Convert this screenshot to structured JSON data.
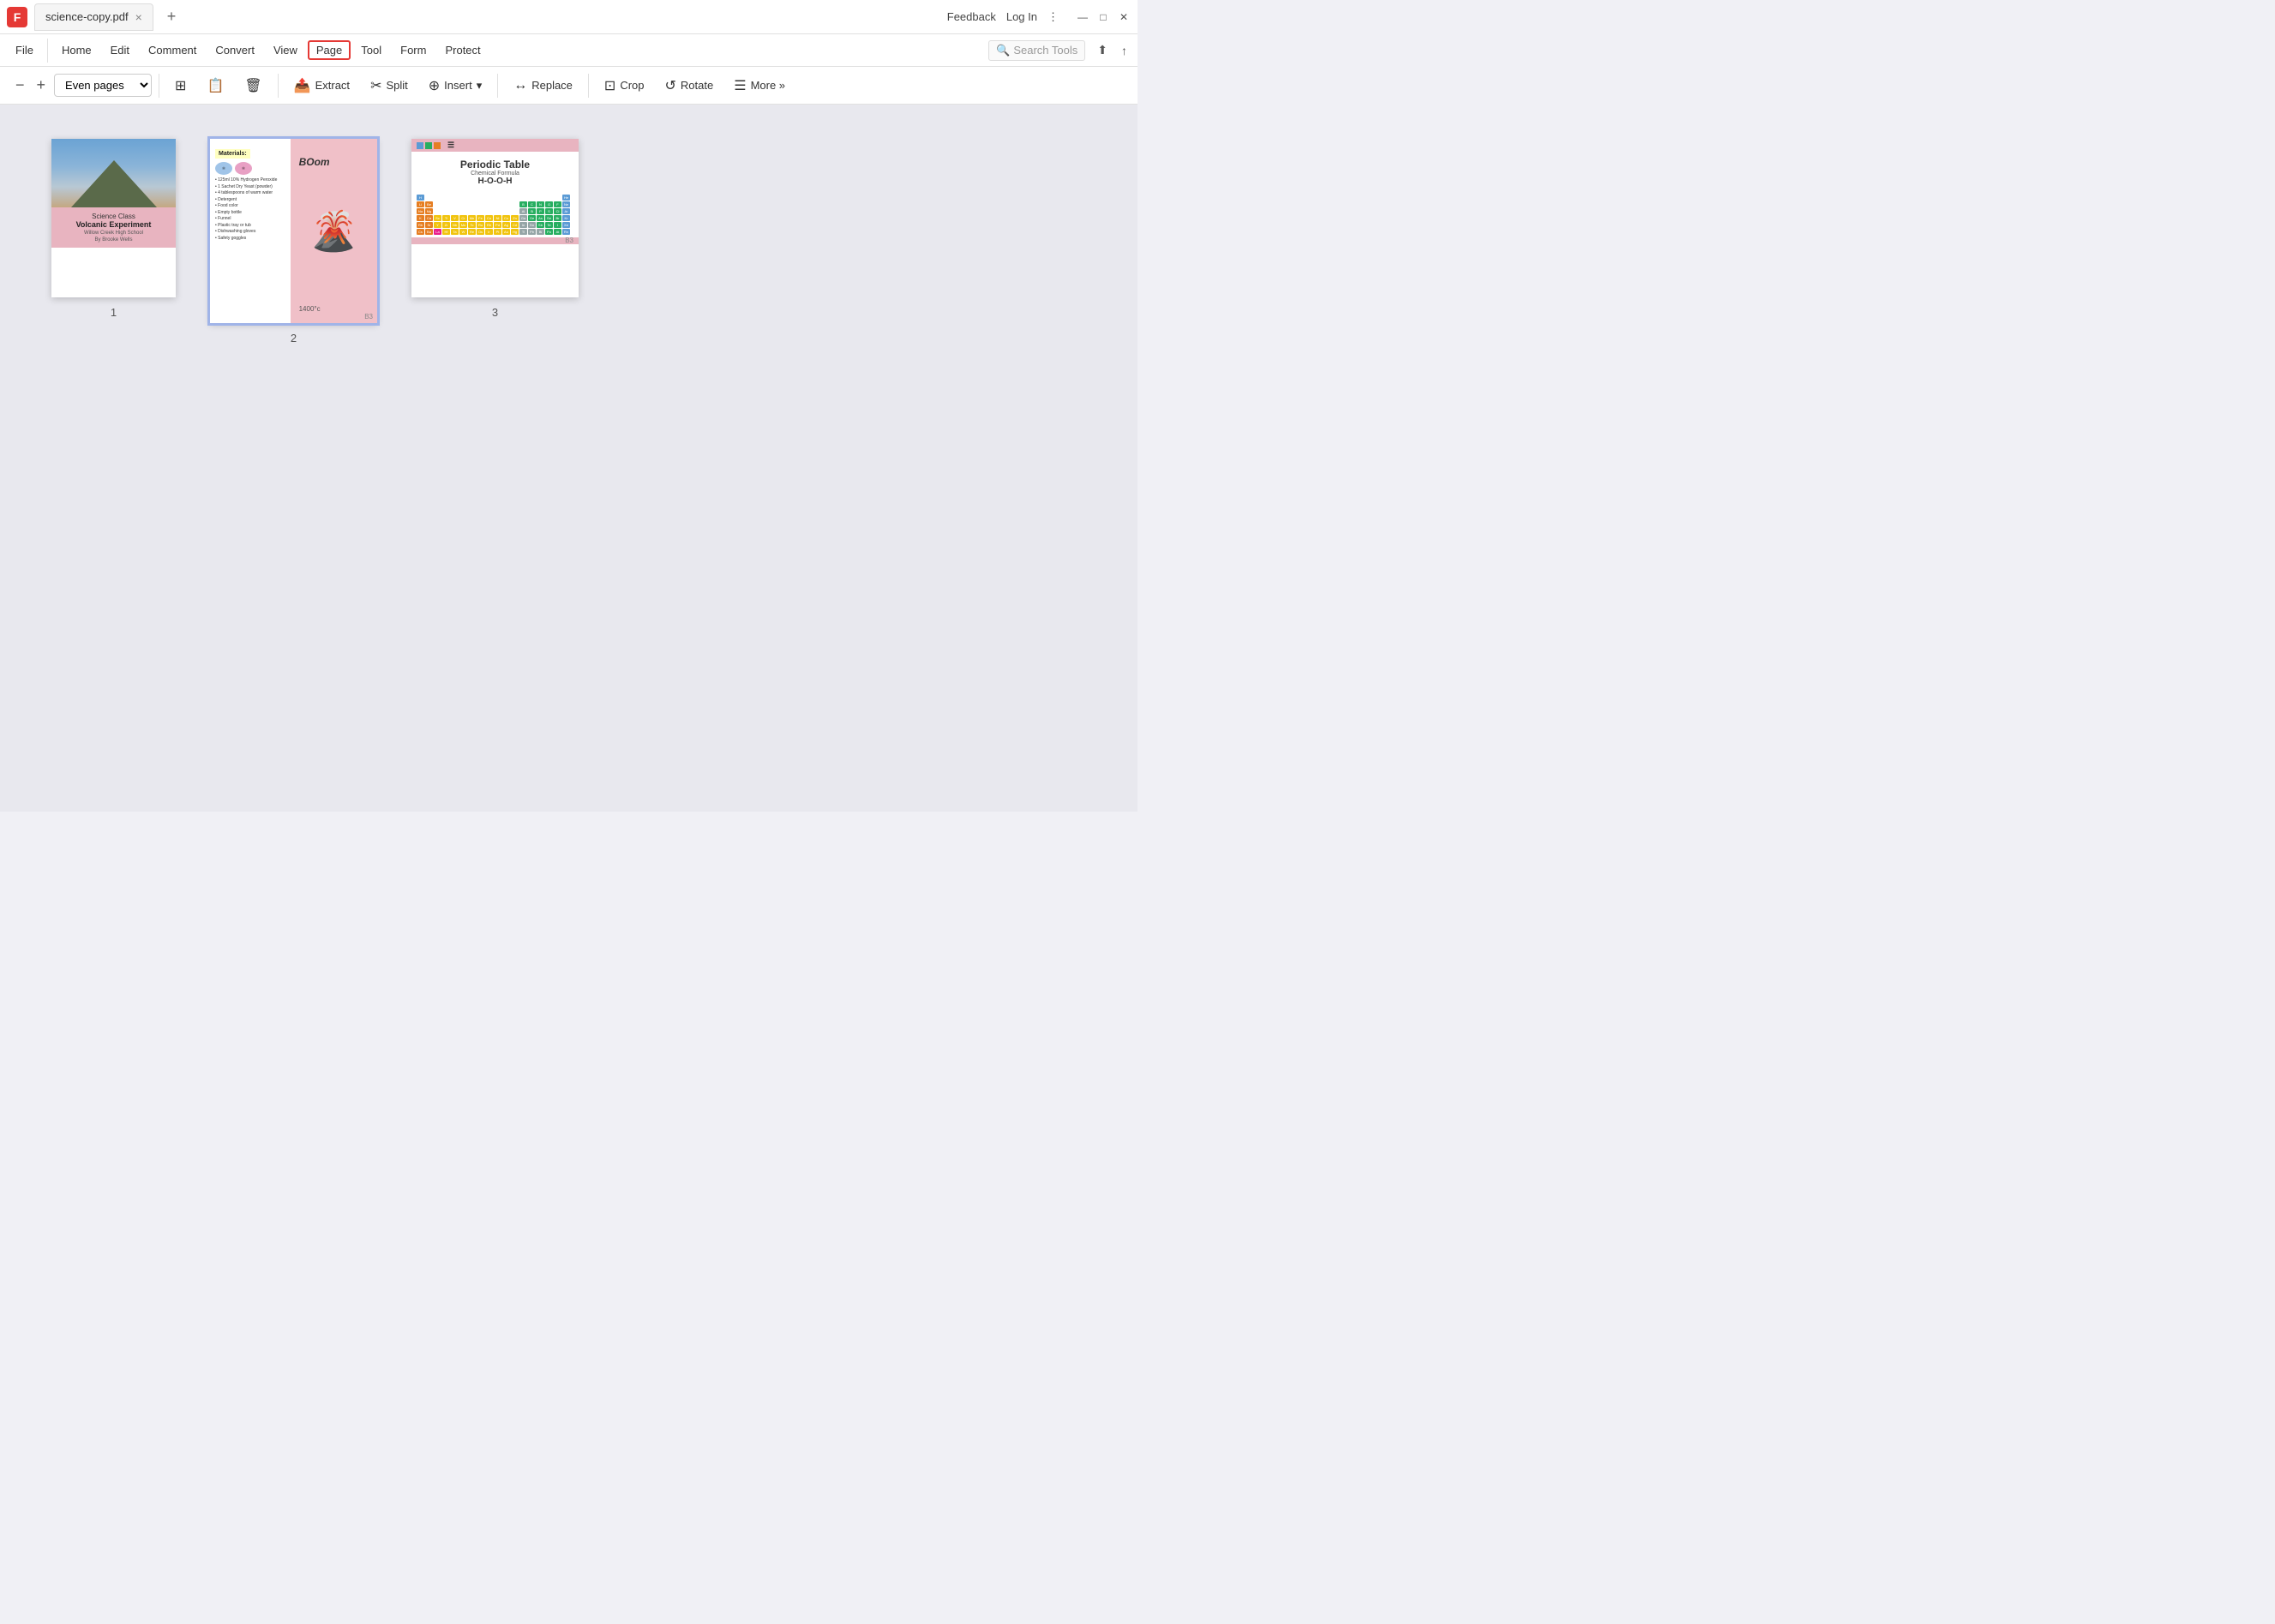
{
  "titlebar": {
    "app_icon": "F",
    "tab_name": "science-copy.pdf",
    "close_tab": "×",
    "add_tab": "+",
    "feedback": "Feedback",
    "login": "Log In",
    "more_options": "⋮",
    "minimize": "—",
    "maximize": "□",
    "close": "✕"
  },
  "menubar": {
    "file": "File",
    "home": "Home",
    "edit": "Edit",
    "comment": "Comment",
    "convert": "Convert",
    "view": "View",
    "page": "Page",
    "tool": "Tool",
    "form": "Form",
    "protect": "Protect",
    "search_tools": "Search Tools",
    "icons": [
      "⬆",
      "↑"
    ]
  },
  "toolbar": {
    "zoom_minus": "−",
    "zoom_plus": "+",
    "page_range": "Even pages",
    "extract": "Extract",
    "split": "Split",
    "insert": "Insert",
    "replace": "Replace",
    "crop": "Crop",
    "rotate": "Rotate",
    "more": "More »",
    "toolbar_icons": {
      "copy": "⊞",
      "save": "💾",
      "delete": "🗑",
      "extract_icon": "📤",
      "split_icon": "✂",
      "insert_icon": "⊕",
      "replace_icon": "↔",
      "crop_icon": "⊡",
      "rotate_icon": "↺"
    }
  },
  "pages": [
    {
      "id": 1,
      "label": "1",
      "selected": false,
      "title": "Science Class",
      "subtitle": "Volcanic Experiment",
      "school": "Willow Creek High School",
      "author": "By Brooke Wells"
    },
    {
      "id": 2,
      "label": "2",
      "selected": true,
      "materials_header": "Materials:",
      "boom": "BOom",
      "page_num": "B3"
    },
    {
      "id": 3,
      "label": "3",
      "selected": false,
      "title": "Periodic Table",
      "chem_formula_label": "Chemical Formula",
      "formula": "H-O-O-H",
      "page_num": "B3"
    }
  ]
}
